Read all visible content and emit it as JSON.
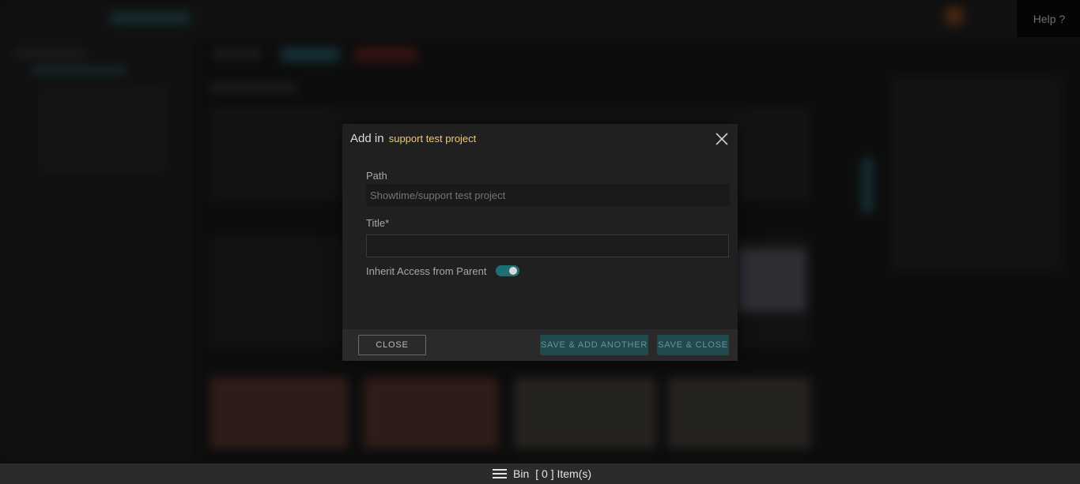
{
  "header": {
    "help_label": "Help ?"
  },
  "modal": {
    "title_prefix": "Add in",
    "project_name": "support test project",
    "path_label": "Path",
    "path_placeholder": "Showtime/support test project",
    "path_value": "",
    "title_label": "Title*",
    "title_value": "",
    "inherit_label": "Inherit Access from Parent",
    "inherit_enabled": true,
    "close_label": "CLOSE",
    "save_add_label": "SAVE & ADD ANOTHER",
    "save_close_label": "SAVE & CLOSE"
  },
  "bin": {
    "label": "Bin",
    "count_text": "[ 0 ] Item(s)"
  },
  "colors": {
    "accent_project": "#f3c96a",
    "toggle_on": "#1e6f75",
    "save_button_bg": "#1f4a4e"
  },
  "icons": {
    "close": "close-icon",
    "menu": "hamburger-icon"
  }
}
